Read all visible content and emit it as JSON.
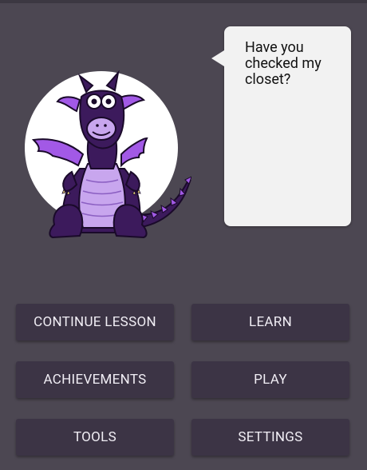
{
  "bubble": {
    "text": "Have you checked my closet?"
  },
  "buttons": {
    "continue_lesson": "CONTINUE LESSON",
    "learn": "LEARN",
    "achievements": "ACHIEVEMENTS",
    "play": "PLAY",
    "tools": "TOOLS",
    "settings": "SETTINGS"
  },
  "colors": {
    "background": "#4c4752",
    "button": "#3c3445",
    "bubble": "#f2f2f2",
    "dragon_body": "#3c1a5c",
    "dragon_belly": "#c8a6ee",
    "dragon_wing": "#a259e6"
  },
  "icons": {
    "mascot": "purple-dragon-mascot"
  }
}
